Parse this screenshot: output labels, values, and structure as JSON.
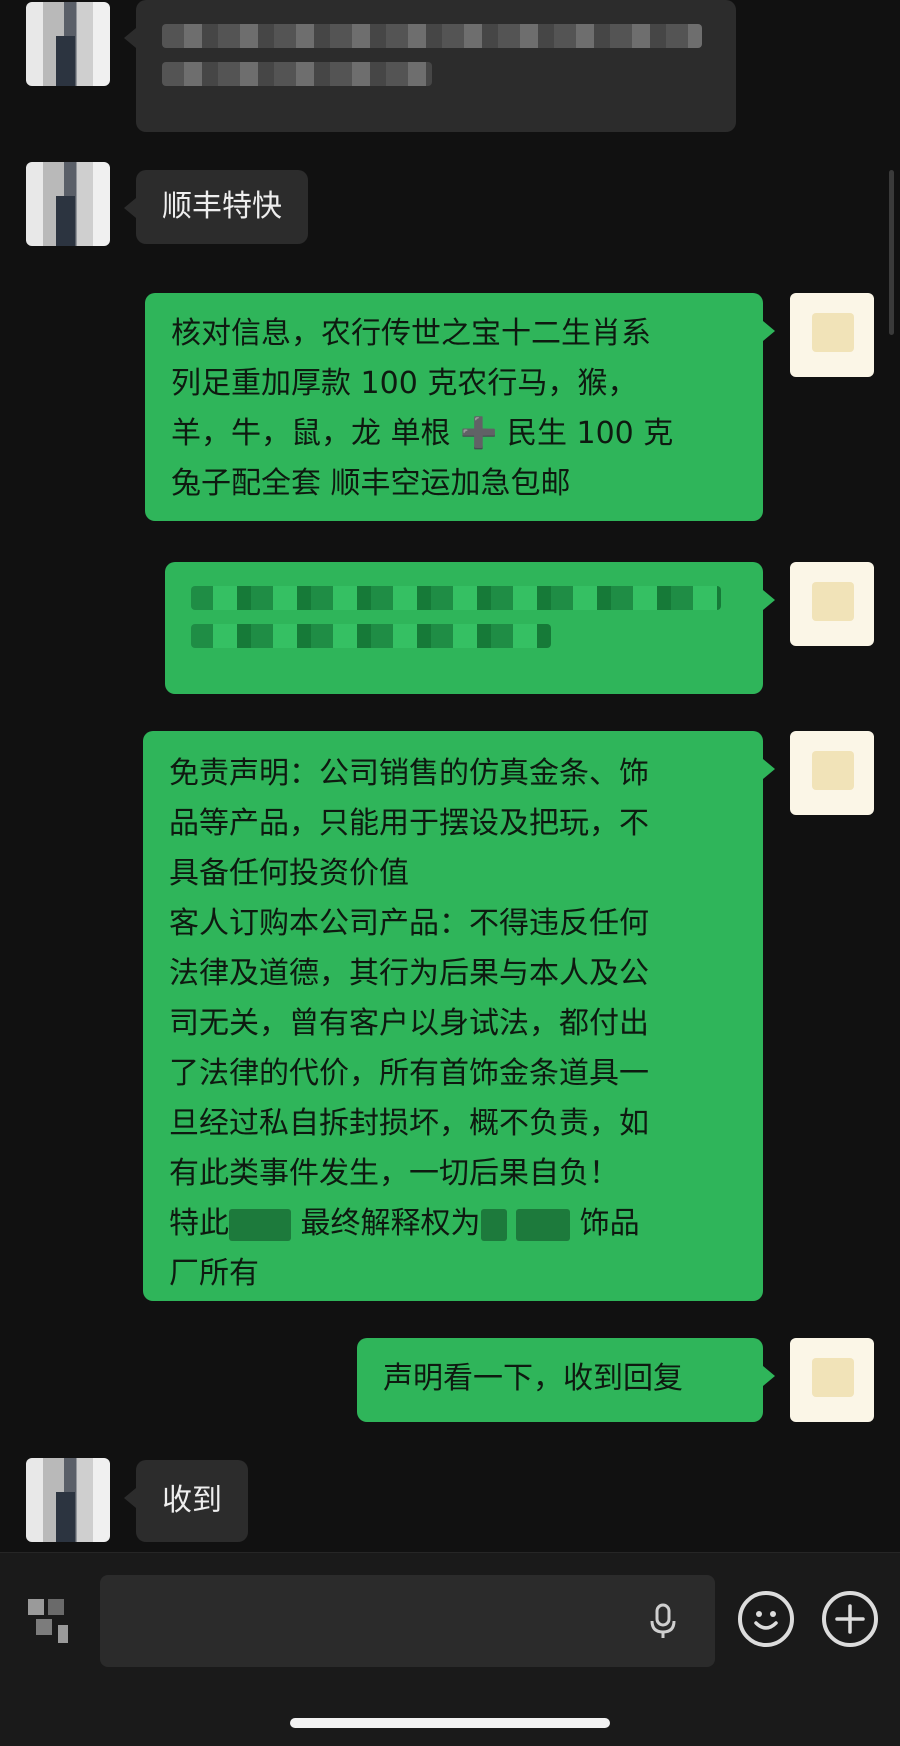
{
  "chat": {
    "messages": [
      {
        "sender": "other",
        "text": ""
      },
      {
        "sender": "other",
        "text": "顺丰特快"
      },
      {
        "sender": "self",
        "lines": [
          "核对信息，农行传世之宝十二生肖系",
          "列足重加厚款 100 克农行马，猴，",
          "羊，牛，鼠，龙 单根 ➕ 民生 100 克",
          "兔子配全套 顺丰空运加急包邮"
        ]
      },
      {
        "sender": "self",
        "text": ""
      },
      {
        "sender": "self",
        "lines": [
          "免责声明：公司销售的仿真金条、饰",
          "品等产品，只能用于摆设及把玩，不",
          "具备任何投资价值",
          "客人订购本公司产品：不得违反任何",
          "法律及道德，其行为后果与本人及公",
          "司无关，曾有客户以身试法，都付出",
          "了法律的代价，所有首饰金条道具一",
          "旦经过私自拆封损坏，概不负责，如",
          "有此类事件发生，一切后果自负！"
        ],
        "line_last_a": "特此",
        "line_last_b": "最终解释权为",
        "line_last_c": "饰品",
        "line_final": "厂所有"
      },
      {
        "sender": "self",
        "text": "声明看一下，收到回复"
      },
      {
        "sender": "other",
        "text": "收到"
      }
    ]
  },
  "input_bar": {
    "voice_icon": "voice-toggle-icon",
    "mic_icon": "microphone-icon",
    "emoji_icon": "emoji-icon",
    "plus_icon": "plus-icon",
    "value": ""
  },
  "colors": {
    "background": "#111111",
    "self_bubble": "#2fb55a",
    "other_bubble": "#2c2c2c"
  }
}
